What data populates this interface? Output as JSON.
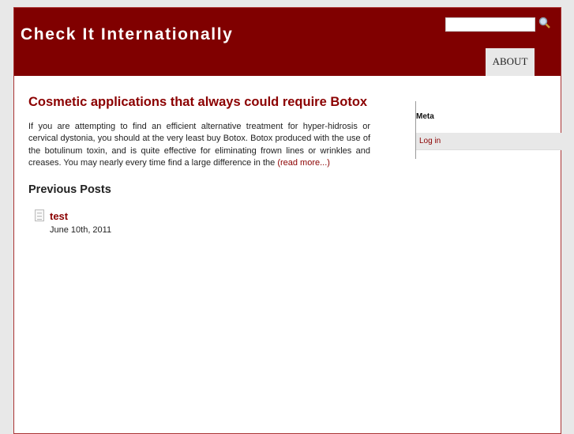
{
  "header": {
    "site_title": "Check It Internationally",
    "search_placeholder": "",
    "nav": [
      {
        "label": "ABOUT"
      }
    ]
  },
  "post": {
    "title": "Cosmetic applications that always could require Botox",
    "body": "If you are attempting to find an efficient alternative treatment for hyper-hidrosis or cervical dystonia, you should at the very least buy Botox. Botox produced with the use of the botulinum toxin, and is quite effective for eliminating frown lines or wrinkles and creases. You may nearly every time find a large difference in the ",
    "read_more": "(read more...)"
  },
  "previous": {
    "heading": "Previous Posts",
    "items": [
      {
        "title": "test",
        "date": "June 10th, 2011"
      }
    ]
  },
  "sidebar": {
    "title": "Meta",
    "links": [
      {
        "label": "Log in"
      }
    ]
  },
  "colors": {
    "brand": "#800000",
    "background": "#e8e8e8"
  }
}
